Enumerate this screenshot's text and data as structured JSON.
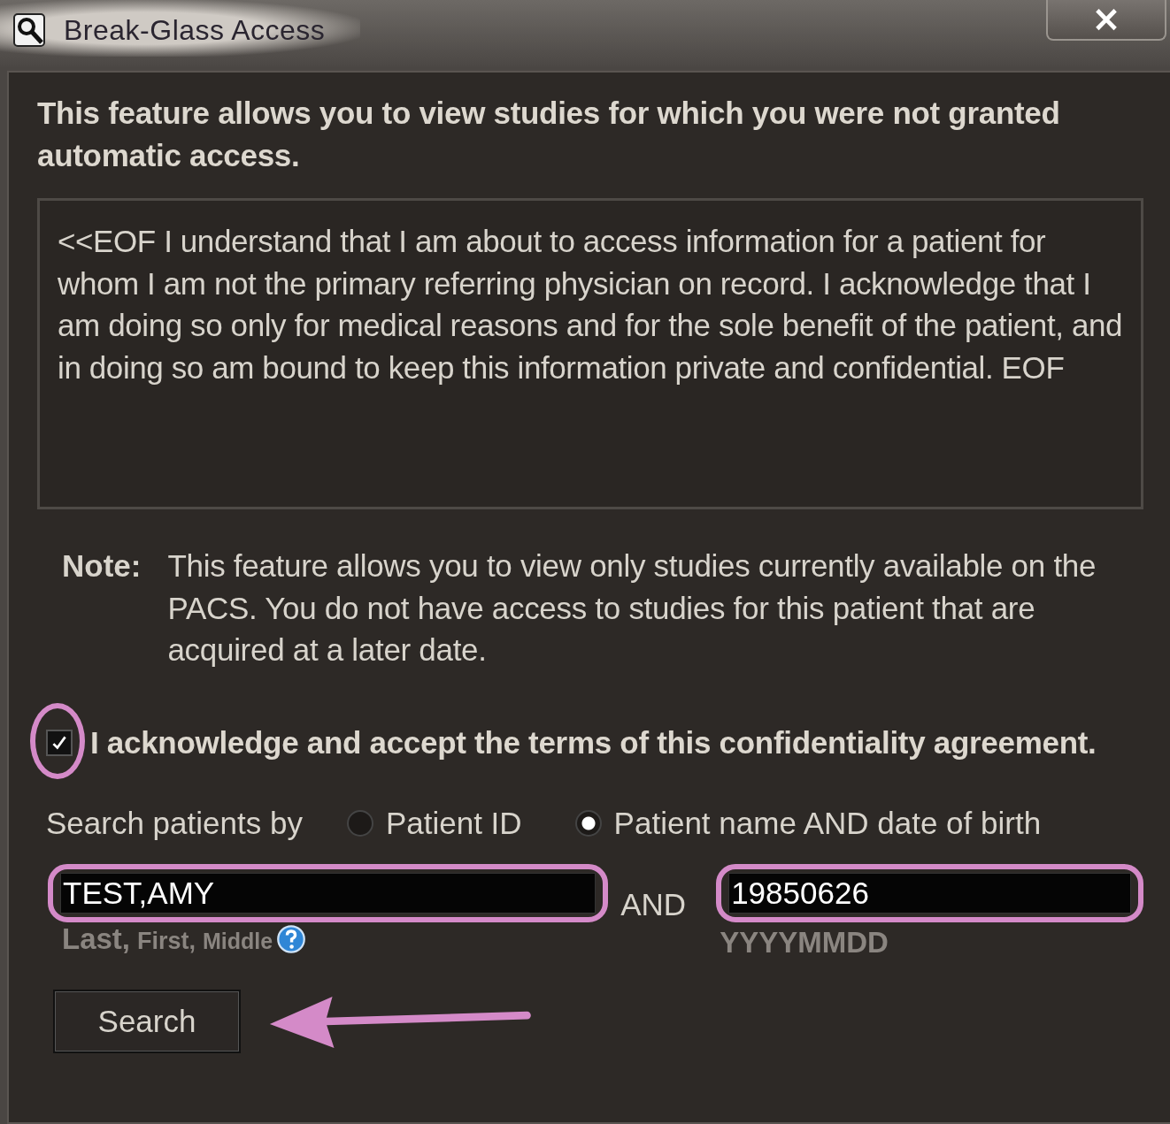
{
  "window": {
    "title": "Break-Glass Access",
    "close_label": "×"
  },
  "intro": "This feature allows you to view studies for which you were not granted automatic access.",
  "agreement_text": "<<EOF I understand that I am about to access information for a patient for whom I am not the primary referring physician on record. I acknowledge that I am doing so only for medical reasons and for the sole benefit of the patient, and in doing so am bound to keep this information private and confidential. EOF",
  "note": {
    "label": "Note:",
    "text": "This feature allows you to view only studies currently available on the PACS. You do not have access to studies for this patient that are acquired at a later date."
  },
  "acknowledge": {
    "label": "I acknowledge and accept the terms of this confidentiality agreement.",
    "checked": true
  },
  "search_by": {
    "label": "Search patients by",
    "options": [
      {
        "label": "Patient ID",
        "selected": false
      },
      {
        "label": "Patient name AND date of birth",
        "selected": true
      }
    ]
  },
  "name_field": {
    "value": "TEST,AMY",
    "hint_parts": [
      "Last,",
      "First,",
      "Middle"
    ]
  },
  "joiner": "AND",
  "dob_field": {
    "value": "19850626",
    "hint": "YYYYMMDD"
  },
  "search_button": "Search"
}
